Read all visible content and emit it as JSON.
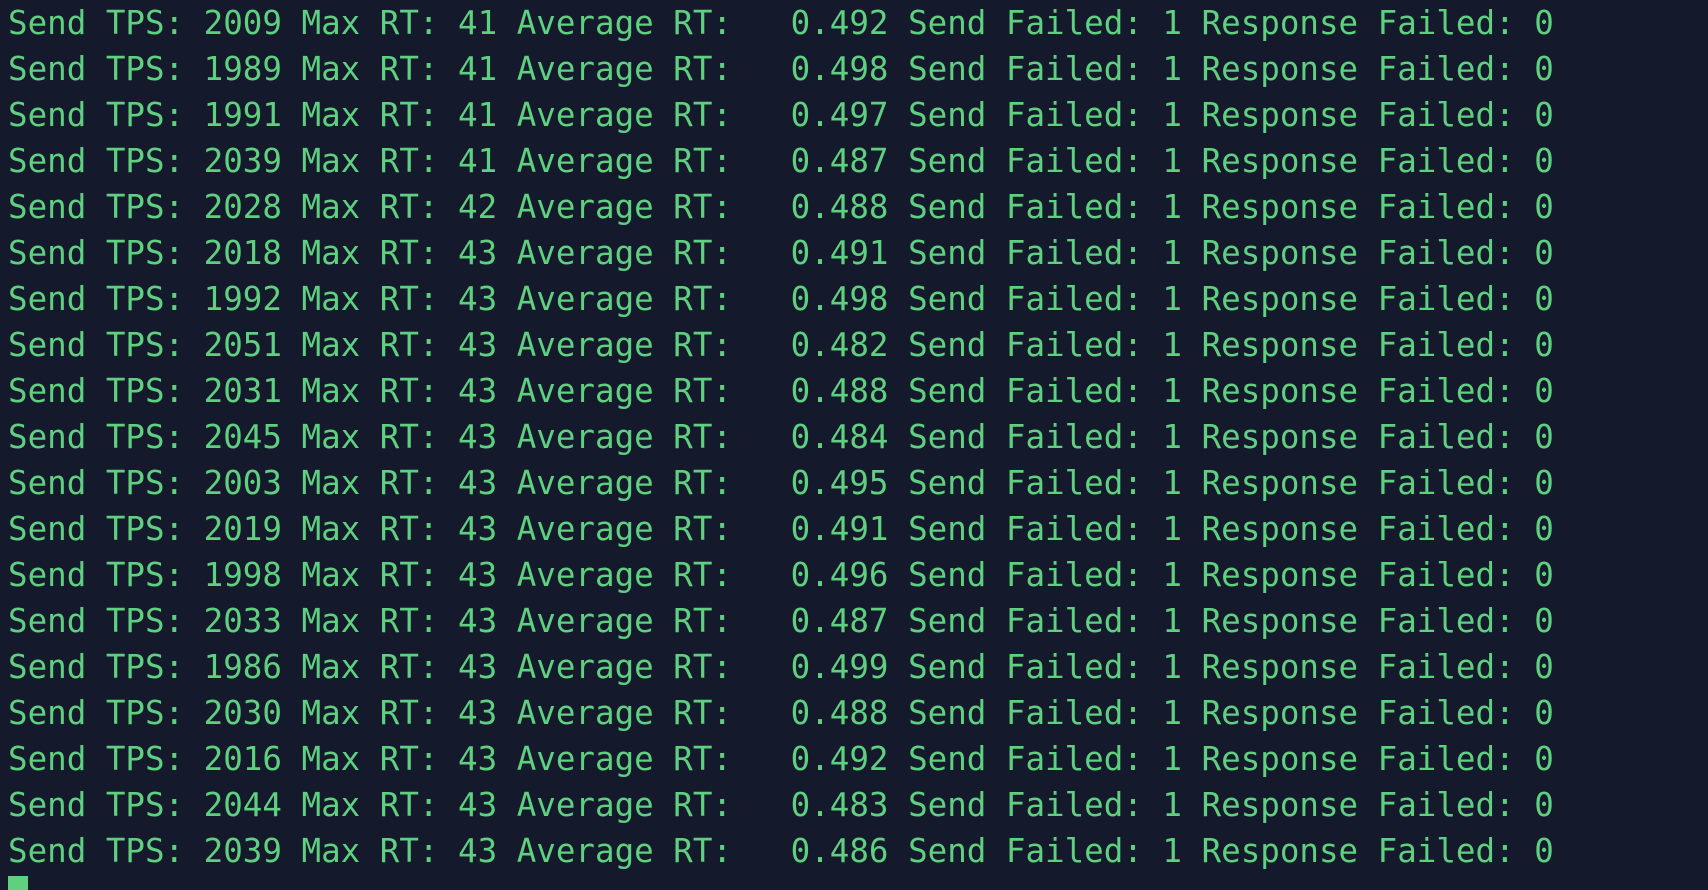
{
  "terminal": {
    "lines": [
      "Send TPS: 2009 Max RT: 41 Average RT:   0.492 Send Failed: 1 Response Failed: 0",
      "Send TPS: 1989 Max RT: 41 Average RT:   0.498 Send Failed: 1 Response Failed: 0",
      "Send TPS: 1991 Max RT: 41 Average RT:   0.497 Send Failed: 1 Response Failed: 0",
      "Send TPS: 2039 Max RT: 41 Average RT:   0.487 Send Failed: 1 Response Failed: 0",
      "Send TPS: 2028 Max RT: 42 Average RT:   0.488 Send Failed: 1 Response Failed: 0",
      "Send TPS: 2018 Max RT: 43 Average RT:   0.491 Send Failed: 1 Response Failed: 0",
      "Send TPS: 1992 Max RT: 43 Average RT:   0.498 Send Failed: 1 Response Failed: 0",
      "Send TPS: 2051 Max RT: 43 Average RT:   0.482 Send Failed: 1 Response Failed: 0",
      "Send TPS: 2031 Max RT: 43 Average RT:   0.488 Send Failed: 1 Response Failed: 0",
      "Send TPS: 2045 Max RT: 43 Average RT:   0.484 Send Failed: 1 Response Failed: 0",
      "Send TPS: 2003 Max RT: 43 Average RT:   0.495 Send Failed: 1 Response Failed: 0",
      "Send TPS: 2019 Max RT: 43 Average RT:   0.491 Send Failed: 1 Response Failed: 0",
      "Send TPS: 1998 Max RT: 43 Average RT:   0.496 Send Failed: 1 Response Failed: 0",
      "Send TPS: 2033 Max RT: 43 Average RT:   0.487 Send Failed: 1 Response Failed: 0",
      "Send TPS: 1986 Max RT: 43 Average RT:   0.499 Send Failed: 1 Response Failed: 0",
      "Send TPS: 2030 Max RT: 43 Average RT:   0.488 Send Failed: 1 Response Failed: 0",
      "Send TPS: 2016 Max RT: 43 Average RT:   0.492 Send Failed: 1 Response Failed: 0",
      "Send TPS: 2044 Max RT: 43 Average RT:   0.483 Send Failed: 1 Response Failed: 0",
      "Send TPS: 2039 Max RT: 43 Average RT:   0.486 Send Failed: 1 Response Failed: 0"
    ]
  },
  "colors": {
    "background": "#141a2b",
    "text": "#5fcf80",
    "cursor": "#5fcf80"
  }
}
